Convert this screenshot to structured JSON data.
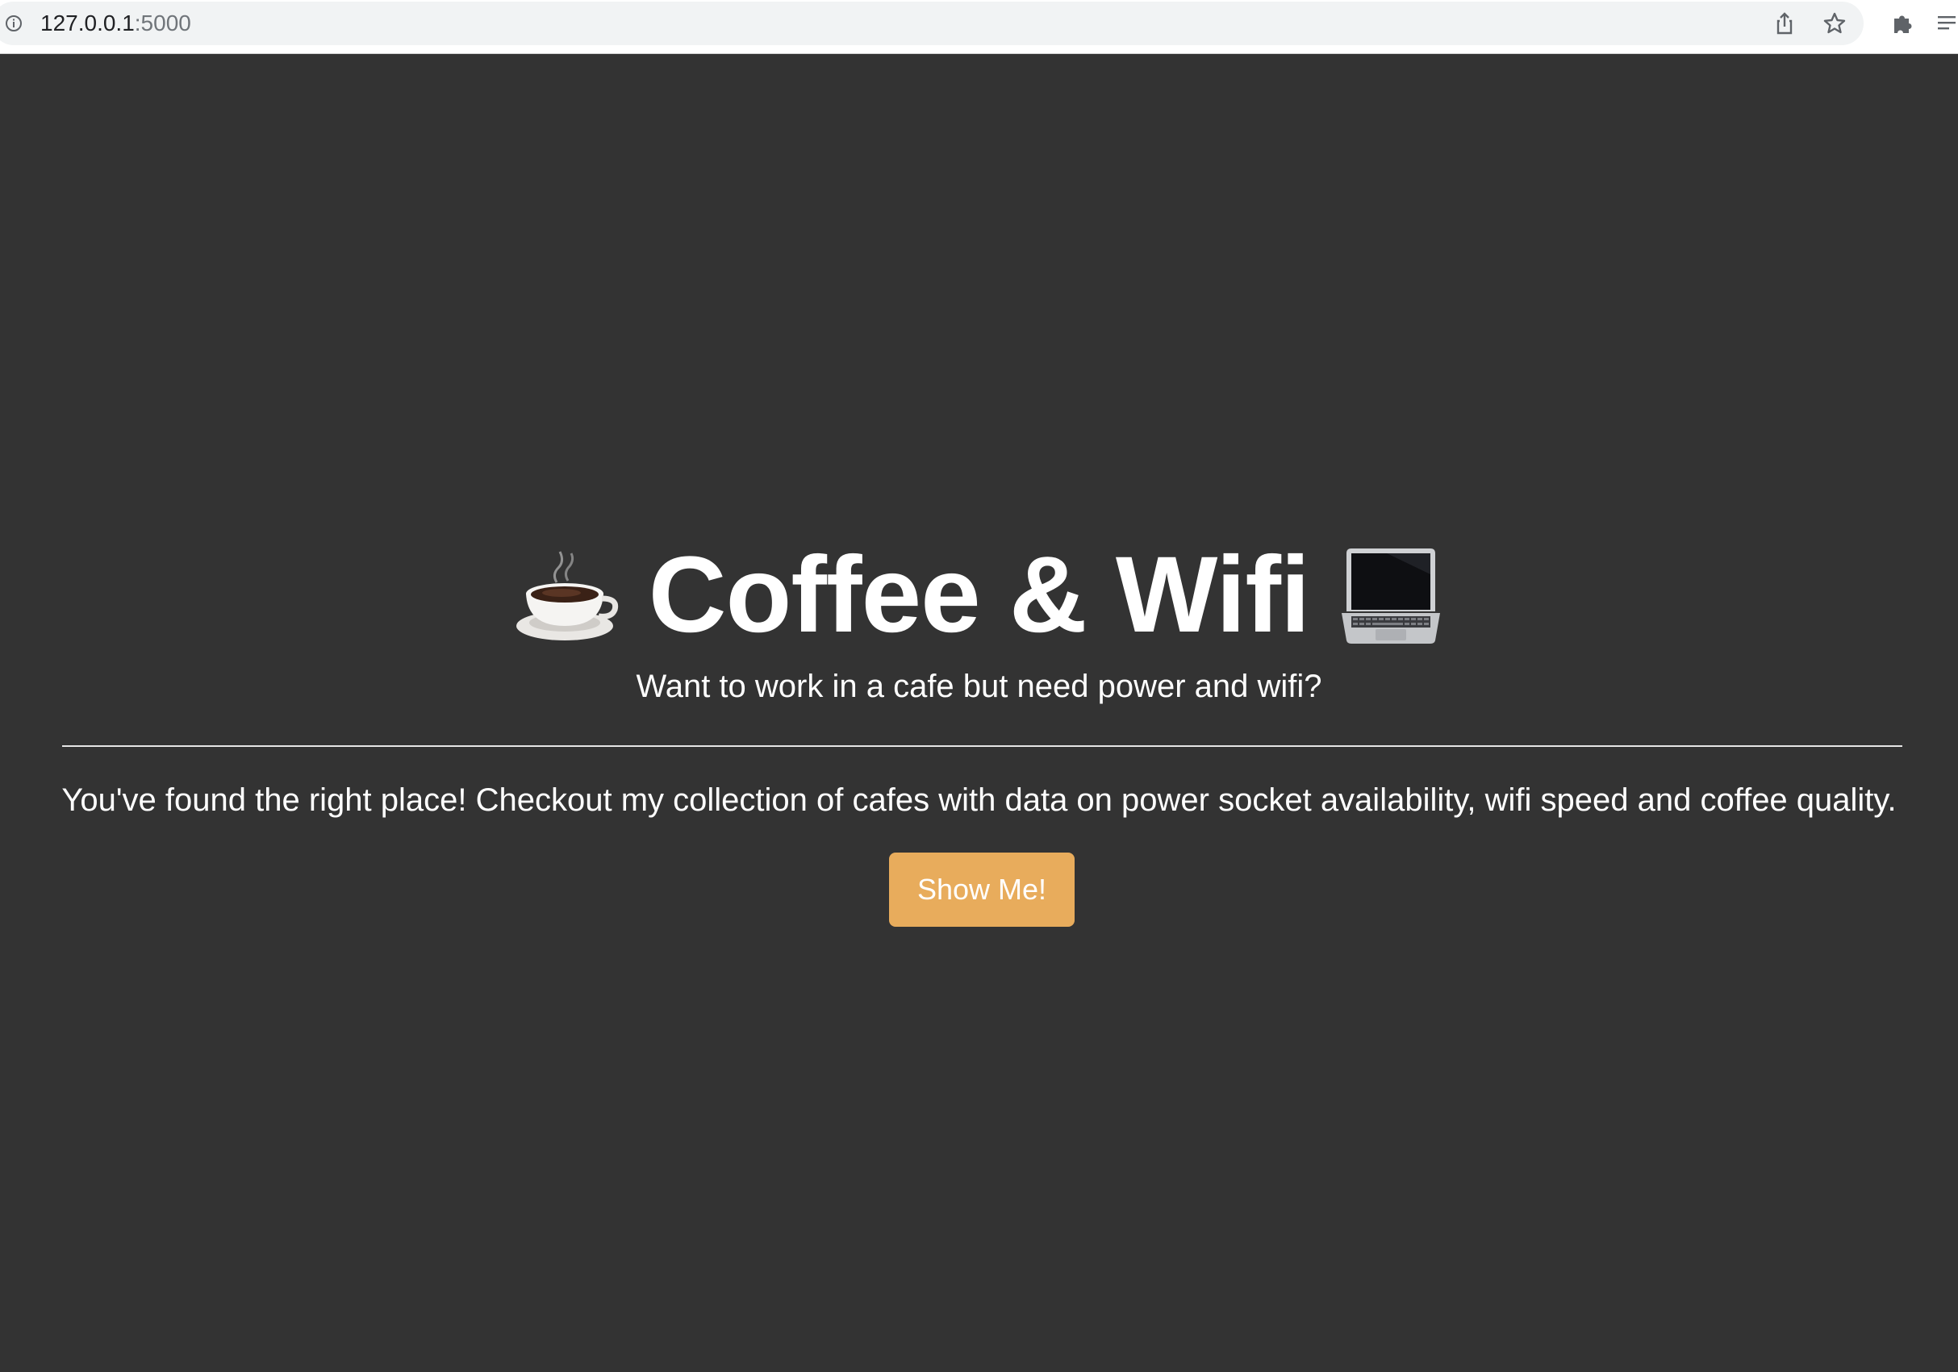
{
  "browser": {
    "url_host": "127.0.0.1",
    "url_port": ":5000",
    "icons": [
      "info-icon",
      "share-icon",
      "star-icon",
      "extensions-puzzle-icon",
      "reading-list-icon"
    ]
  },
  "hero": {
    "title": "Coffee & Wifi",
    "title_left_emoji": "coffee-cup-icon",
    "title_right_emoji": "laptop-icon",
    "subtitle": "Want to work in a cafe but need power and wifi?"
  },
  "lead": "You've found the right place! Checkout my collection of cafes with data on power socket availability, wifi speed and coffee quality.",
  "cta": {
    "label": "Show Me!"
  },
  "colors": {
    "background": "#333333",
    "text": "#ffffff",
    "button": "#e8ac5c",
    "divider": "#e6e6e6"
  }
}
